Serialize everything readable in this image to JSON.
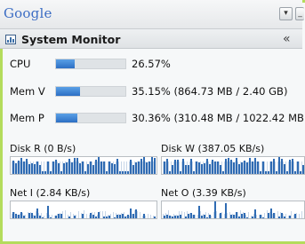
{
  "toolbar": {
    "logo": "Google"
  },
  "header": {
    "title": "System Monitor",
    "collapse_glyph": "«"
  },
  "metrics": [
    {
      "label": "CPU",
      "text": "26.57%",
      "percent": 26.57
    },
    {
      "label": "Mem V",
      "text": "35.15% (864.73 MB / 2.40 GB)",
      "percent": 35.15
    },
    {
      "label": "Mem P",
      "text": "30.36% (310.48 MB / 1022.42 MB",
      "percent": 30.36
    }
  ],
  "activity": {
    "disk_read": "Disk R (0 B/s)",
    "disk_write": "Disk W (387.05 KB/s)",
    "net_in": "Net I (2.84 KB/s)",
    "net_out": "Net O (3.39 KB/s)"
  },
  "colors": {
    "accent": "#b4dc5c",
    "bar": "#2c6fc4"
  },
  "icons": [
    "dropdown-icon",
    "minimize-icon",
    "system-monitor-icon",
    "collapse-icon"
  ]
}
